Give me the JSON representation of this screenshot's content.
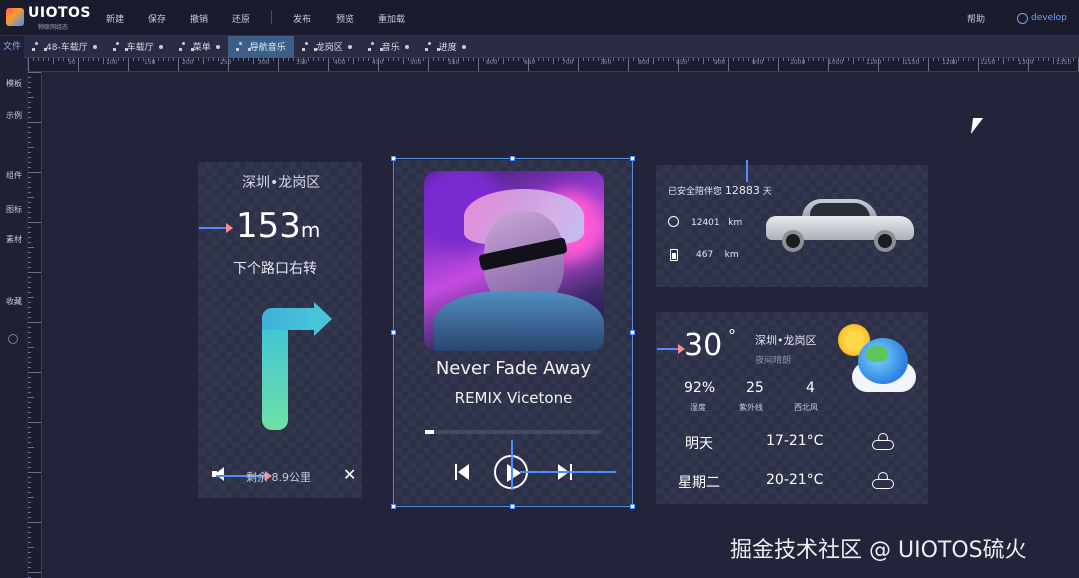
{
  "app": {
    "logo": "UIOTOS",
    "logo_sub": "物联网组态"
  },
  "toolbar": {
    "items": [
      "新建",
      "保存",
      "撤销",
      "还原",
      "发布",
      "预览",
      "重加载"
    ],
    "help": "帮助",
    "user": "develop"
  },
  "tabs": {
    "file": "文件",
    "items": [
      "48-车载厅",
      "车载厅",
      "菜单",
      "导航音乐",
      "龙岗区",
      "音乐",
      "进度"
    ],
    "active": 3
  },
  "sidebar": {
    "items": [
      "模板",
      "示例",
      "组件",
      "图标",
      "素材",
      "收藏"
    ]
  },
  "ruler": {
    "h_labels": [
      "50",
      "100",
      "150",
      "200",
      "250",
      "300",
      "350",
      "400",
      "450",
      "500",
      "550",
      "600",
      "650",
      "700",
      "750",
      "800",
      "850",
      "900",
      "950",
      "1000",
      "1050",
      "1100",
      "1150",
      "1200",
      "1250",
      "1300",
      "1350"
    ]
  },
  "nav": {
    "location": "深圳•龙岗区",
    "distance_value": "153",
    "distance_unit": "m",
    "instruction": "下个路口右转",
    "remaining": "剩余 8.9公里",
    "close": "✕"
  },
  "music": {
    "song": "Never Fade Away",
    "artist": "REMIX Vicetone",
    "progress": 0.05
  },
  "car": {
    "safe_prefix": "已安全陪伴您",
    "safe_days": "12883",
    "safe_suffix": "天",
    "mileage": "12401",
    "mileage_unit": "km",
    "range": "467",
    "range_unit": "km"
  },
  "weather": {
    "temp": "30",
    "deg": "°",
    "city": "深圳•龙岗区",
    "desc": "夜间晴朗",
    "humidity": "92%",
    "humidity_label": "湿度",
    "uv": "25",
    "uv_label": "紫外线",
    "wind": "4",
    "wind_label": "西北风",
    "forecast": [
      {
        "day": "明天",
        "range": "17-21°C"
      },
      {
        "day": "星期二",
        "range": "20-21°C"
      }
    ]
  },
  "watermark": "掘金技术社区 @ UIOTOS硫火",
  "colors": {
    "accent": "#4d8dff",
    "topbar": "#1a1b2c",
    "card": "#2c3048",
    "active_tab": "#3b5f88"
  }
}
